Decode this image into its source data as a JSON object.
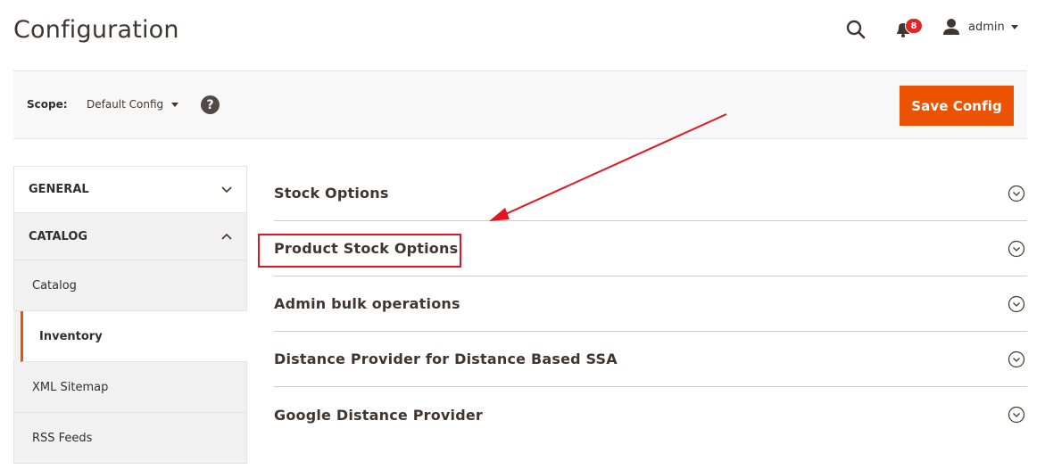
{
  "header": {
    "title": "Configuration",
    "notifications_count": "8",
    "user_name": "admin"
  },
  "scope": {
    "label": "Scope:",
    "value": "Default Config",
    "help": "?",
    "save_label": "Save Config"
  },
  "sidebar": {
    "sections": [
      {
        "label": "GENERAL",
        "expanded": false
      },
      {
        "label": "CATALOG",
        "expanded": true
      }
    ],
    "items": [
      {
        "label": "Catalog",
        "active": false
      },
      {
        "label": "Inventory",
        "active": true
      },
      {
        "label": "XML Sitemap",
        "active": false
      },
      {
        "label": "RSS Feeds",
        "active": false
      }
    ]
  },
  "groups": [
    {
      "title": "Stock Options"
    },
    {
      "title": "Product Stock Options",
      "highlighted": true
    },
    {
      "title": "Admin bulk operations"
    },
    {
      "title": "Distance Provider for Distance Based SSA"
    },
    {
      "title": "Google Distance Provider"
    }
  ],
  "colors": {
    "accent": "#eb5202",
    "badge": "#e22626",
    "annotation": "#e5141e",
    "text_dark": "#41362f"
  }
}
